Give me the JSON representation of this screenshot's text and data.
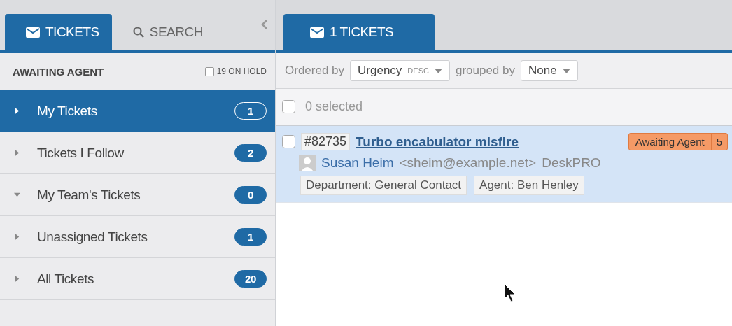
{
  "left_tabs": [
    {
      "label": "TICKETS",
      "selected": true
    },
    {
      "label": "SEARCH",
      "selected": false
    }
  ],
  "sidebar": {
    "heading": "AWAITING AGENT",
    "on_hold": {
      "label": "19 ON HOLD",
      "checked": false
    },
    "items": [
      {
        "label": "My Tickets",
        "count": "1",
        "selected": true,
        "expanded": false
      },
      {
        "label": "Tickets I Follow",
        "count": "2",
        "selected": false,
        "expanded": false
      },
      {
        "label": "My Team's Tickets",
        "count": "0",
        "selected": false,
        "expanded": true
      },
      {
        "label": "Unassigned Tickets",
        "count": "1",
        "selected": false,
        "expanded": false
      },
      {
        "label": "All Tickets",
        "count": "20",
        "selected": false,
        "expanded": false
      }
    ]
  },
  "main_tabs": [
    {
      "label": "1 TICKETS",
      "selected": true
    }
  ],
  "toolbar": {
    "ordered_label": "Ordered by",
    "order_value": "Urgency",
    "order_dir": "DESC",
    "grouped_label": "grouped by",
    "group_value": "None"
  },
  "selection": {
    "label": "0 selected",
    "checked": false
  },
  "tickets": [
    {
      "id": "#82735",
      "subject": "Turbo encabulator misfire",
      "status": "Awaiting Agent",
      "status_count": "5",
      "person": "Susan Heim",
      "email": "<sheim@example.net>",
      "org": "DeskPRO",
      "tags": [
        "Department: General Contact",
        "Agent: Ben Henley"
      ],
      "selected": true,
      "checked": false
    }
  ]
}
